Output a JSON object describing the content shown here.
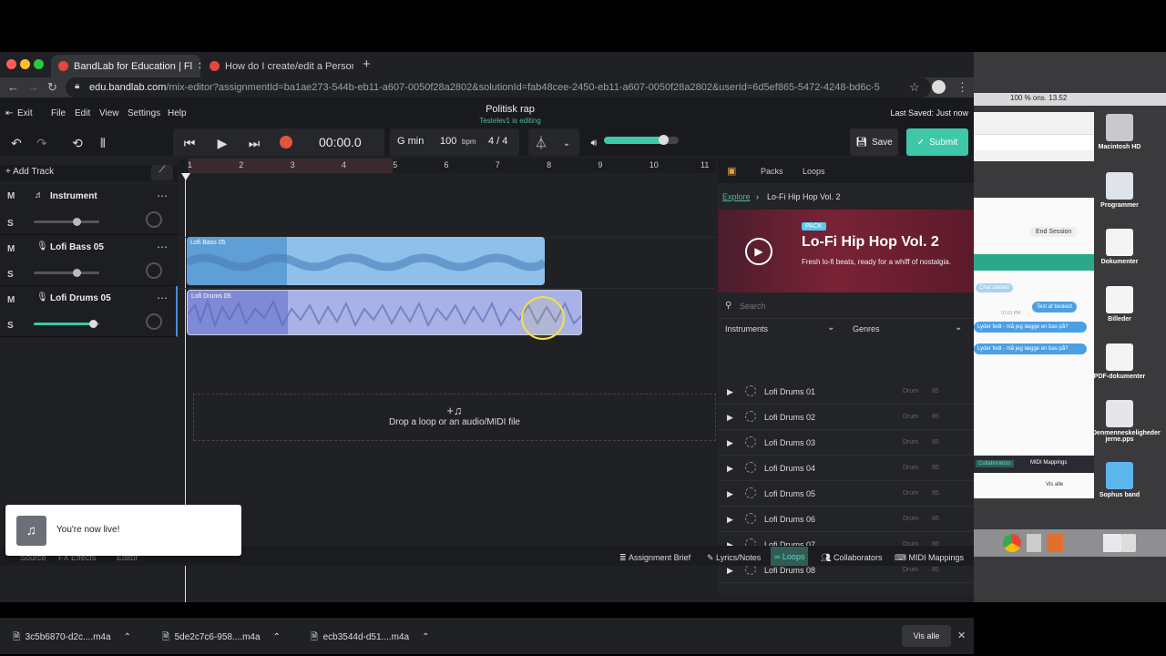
{
  "browser": {
    "tabs": [
      {
        "label": "BandLab for Education | Fl",
        "active": true
      },
      {
        "label": "How do I create/edit a Persona",
        "active": false
      }
    ],
    "url_domain": "edu.bandlab.com",
    "url_path": "/mix-editor?assignmentId=ba1ae273-544b-eb11-a607-0050f28a2802&solutionId=fab48cee-2450-eb11-a607-0050f28a2802&userId=6d5ef865-5472-4248-bd6c-5"
  },
  "menubar": {
    "exit": "Exit",
    "items": [
      "File",
      "Edit",
      "View",
      "Settings",
      "Help"
    ],
    "project_title": "Politisk rap",
    "editing_status": "Testelev1 is editing",
    "last_saved": "Last Saved: Just now"
  },
  "transport": {
    "time": "00:00.0",
    "key": "G min",
    "bpm_value": "100",
    "bpm_unit": "bpm",
    "time_signature": "4 / 4",
    "volume_level": 0.8,
    "save_label": "Save",
    "submit_label": "Submit"
  },
  "tracks": {
    "add_track": "Add Track",
    "mute": "M",
    "solo": "S",
    "items": [
      {
        "name": "Instrument",
        "volume": 0.65
      },
      {
        "name": "Lofi Bass 05",
        "volume": 0.65
      },
      {
        "name": "Lofi Drums 05",
        "volume": 0.9
      }
    ]
  },
  "timeline": {
    "bars": [
      "1",
      "2",
      "3",
      "4",
      "5",
      "6",
      "7",
      "8",
      "9",
      "10",
      "11"
    ],
    "clips": [
      {
        "name": "Lofi Bass 05"
      },
      {
        "name": "Lofi Drums 05"
      }
    ],
    "drop_text": "Drop a loop or an audio/MIDI file",
    "drop_icon": "+♫"
  },
  "panel": {
    "tabs": [
      "Packs",
      "Loops"
    ],
    "breadcrumb_root": "Explore",
    "breadcrumb_current": "Lo-Fi Hip Hop Vol. 2",
    "pack_badge": "PACK",
    "pack_title": "Lo-Fi Hip Hop Vol. 2",
    "pack_desc": "Fresh lo-fi beats, ready for a whiff of nostalgia.",
    "search_placeholder": "Search",
    "filter_instruments": "Instruments",
    "filter_genres": "Genres",
    "loops": [
      {
        "name": "Lofi Drums 01",
        "type": "Drum",
        "bpm": "85"
      },
      {
        "name": "Lofi Drums 02",
        "type": "Drum",
        "bpm": "85"
      },
      {
        "name": "Lofi Drums 03",
        "type": "Drum",
        "bpm": "85"
      },
      {
        "name": "Lofi Drums 04",
        "type": "Drum",
        "bpm": "85"
      },
      {
        "name": "Lofi Drums 05",
        "type": "Drum",
        "bpm": "85"
      },
      {
        "name": "Lofi Drums 06",
        "type": "Drum",
        "bpm": "85"
      },
      {
        "name": "Lofi Drums 07",
        "type": "Drum",
        "bpm": "85"
      },
      {
        "name": "Lofi Drums 08",
        "type": "Drum",
        "bpm": "85"
      }
    ]
  },
  "bottombar": {
    "left_items": [
      "Source",
      "FX Effects",
      "Editor"
    ],
    "items": [
      "Assignment Brief",
      "Lyrics/Notes",
      "Loops",
      "Collaborators",
      "MIDI Mappings"
    ],
    "active": "Loops"
  },
  "toast": {
    "text": "You're now live!"
  },
  "downloads": {
    "files": [
      "3c5b6870-d2c....m4a",
      "5de2c7c6-958....m4a",
      "ecb3544d-d51....m4a"
    ],
    "show_all": "Vis alle"
  },
  "mac": {
    "menubar_text": "100 %  ons. 13.52",
    "chat": {
      "end_session": "End Session",
      "chat_started": "Chat started",
      "time": "01:01 PM",
      "messages": [
        "Test af besked",
        "Lyder fedt - må jeg lægge en bas på?",
        "Lyder fedt - må jeg lægge en bas på?"
      ],
      "collaborators": "Collaborators",
      "midi": "MIDI Mappings",
      "show_all": "Vis alle"
    },
    "desktop_icons": [
      "Macintosh HD",
      "Programmer",
      "Dokumenter",
      "Billeder",
      "PDF-dokumenter",
      "Denmenneskeligheder jerne.pps",
      "Sophus band"
    ]
  }
}
